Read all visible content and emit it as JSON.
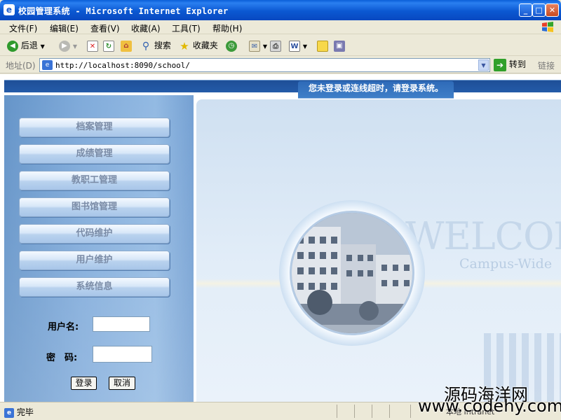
{
  "window": {
    "title": "校园管理系统 - Microsoft Internet Explorer"
  },
  "menu": [
    "文件(F)",
    "编辑(E)",
    "查看(V)",
    "收藏(A)",
    "工具(T)",
    "帮助(H)"
  ],
  "toolbar": {
    "back": "后退",
    "search": "搜索",
    "favorites": "收藏夹"
  },
  "address": {
    "label": "地址(D)",
    "url": "http://localhost:8090/school/",
    "go": "转到",
    "links": "链接"
  },
  "page": {
    "notice": "您未登录或连线超时，请登录系统。",
    "nav": [
      "档案管理",
      "成绩管理",
      "教职工管理",
      "图书馆管理",
      "代码维护",
      "用户维护",
      "系统信息"
    ],
    "login": {
      "username_label": "用户名:",
      "password_label": "密　码:",
      "login_button": "登录",
      "cancel_button": "取消"
    },
    "welcome": "WELCOM",
    "campus": "Campus-Wide"
  },
  "status": {
    "text": "完毕",
    "zone": "本地 Intranet"
  },
  "watermark": {
    "line1": "源码海洋网",
    "line2": "www.codehy.com"
  }
}
